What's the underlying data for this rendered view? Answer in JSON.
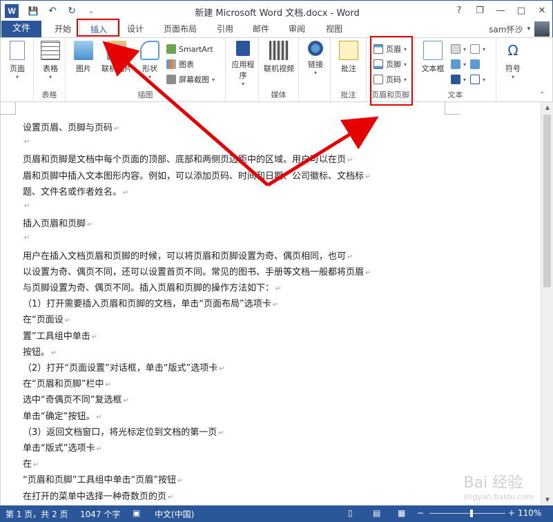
{
  "window": {
    "title": "新建 Microsoft Word 文档.docx - Word",
    "logo_text": "W",
    "help": "?",
    "controls": {
      "restore": "❐",
      "minimize": "—",
      "maximize": "□",
      "close": "✕"
    }
  },
  "qat": {
    "save": "💾",
    "undo": "↶",
    "redo": "↻",
    "more": "⌄"
  },
  "tabs": {
    "file": "文件",
    "items": [
      "开始",
      "插入",
      "设计",
      "页面布局",
      "引用",
      "邮件",
      "审阅",
      "视图"
    ],
    "active": "插入"
  },
  "user": {
    "name": "sam怀沙",
    "caret": "▾"
  },
  "ribbon": {
    "groups": {
      "pages": {
        "label": "",
        "buttons": {
          "page": "页面"
        }
      },
      "tables": {
        "label": "表格",
        "buttons": {
          "table": "表格"
        }
      },
      "illustrations": {
        "label": "插图",
        "buttons": {
          "picture": "图片",
          "online_picture": "联机图片",
          "shapes": "形状",
          "smartart": "SmartArt",
          "chart": "图表",
          "screenshot": "屏幕截图"
        }
      },
      "apps": {
        "label": "",
        "buttons": {
          "apps": "应用程序"
        }
      },
      "media": {
        "label": "媒体",
        "buttons": {
          "online_video": "联机视频"
        }
      },
      "links": {
        "label": "",
        "buttons": {
          "link": "链接"
        }
      },
      "comments": {
        "label": "批注",
        "buttons": {
          "comment": "批注"
        }
      },
      "header_footer": {
        "label": "页眉和页脚",
        "buttons": {
          "header": "页眉",
          "footer": "页脚",
          "page_number": "页码"
        }
      },
      "text": {
        "label": "文本",
        "buttons": {
          "textbox": "文本框"
        }
      },
      "symbols": {
        "label": "",
        "buttons": {
          "symbol": "符号"
        }
      }
    },
    "dropdown_caret": "▾"
  },
  "document": {
    "lines": [
      "设置页眉、页脚与页码",
      "",
      "页眉和页脚是文档中每个页面的顶部、底部和两侧页边距中的区域。用户可以在页",
      "眉和页脚中插入文本图形内容。例如，可以添加页码、时间和日期、公司徽标、文档标",
      "题、文件名或作者姓名。",
      "",
      "插入页眉和页脚",
      "",
      "用户在插入文档页眉和页脚的时候，可以将页眉和页脚设置为奇、偶页相同，也可",
      "以设置为奇、偶页不同，还可以设置首页不同。常见的图书、手册等文档一般都将页眉",
      "与页脚设置为奇、偶页不同。插入页眉和页脚的操作方法如下：",
      "（1）打开需要插入页眉和页脚的文档，单击“页面布局”选项卡",
      "在“页面设",
      "置”工具组中单击",
      "按钮。",
      "（2）打开“页面设置”对话框，单击“版式”选项卡",
      "在“页眉和页脚”栏中",
      "选中“奇偶页不同”复选框",
      "单击“确定”按钮。",
      "（3）返回文档窗口，将光标定位到文档的第一页",
      "单击“版式”选项卡",
      "在",
      "“页眉和页脚”工具组中单击“页眉”按钮",
      "在打开的菜单中选择一种奇数页的页"
    ],
    "para_mark": "↵"
  },
  "status": {
    "page": "第 1 页，共 2 页",
    "words": "1047 个字",
    "language": "中文(中国)",
    "zoom": "110%",
    "zoom_minus": "−",
    "zoom_plus": "+",
    "zoom_level": 0.55
  },
  "watermark": {
    "text": "Bai 经验",
    "sub": "jingyan.baidu.com"
  },
  "colors": {
    "accent": "#2b579a",
    "annotation": "#e60000"
  }
}
